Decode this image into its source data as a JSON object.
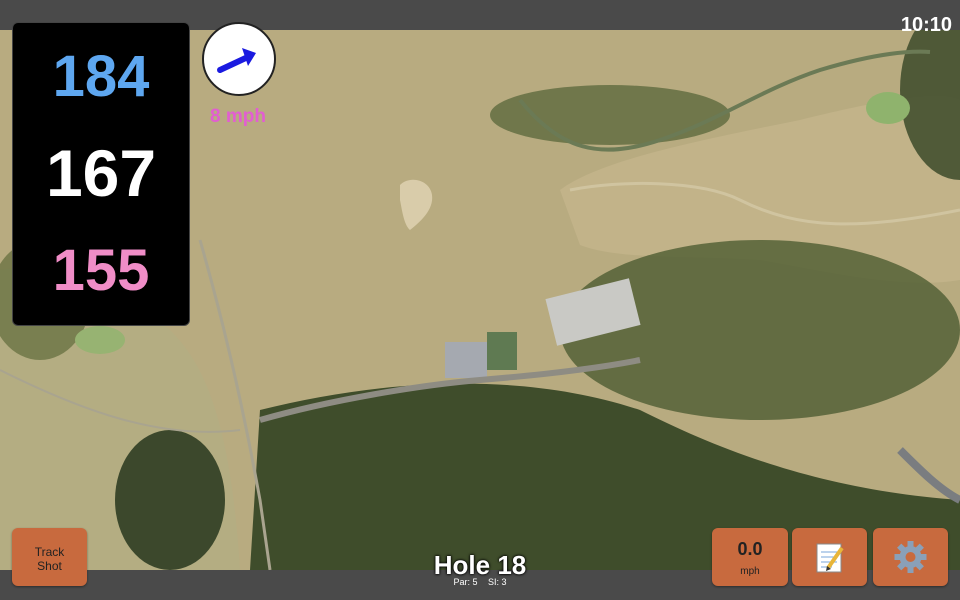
{
  "status_bar": {
    "time": "10:10"
  },
  "distances": {
    "back": "184",
    "middle": "167",
    "front": "155"
  },
  "wind": {
    "speed": "8 mph",
    "icon": "wind-arrow-icon"
  },
  "hole": {
    "title": "Hole 18",
    "par": "Par: 5",
    "stroke_index": "SI: 3"
  },
  "buttons": {
    "track_shot": {
      "line1": "Track",
      "line2": "Shot"
    },
    "speed": {
      "value": "0.0",
      "unit": "mph"
    },
    "notes": {
      "icon": "notepad-icon"
    },
    "settings": {
      "icon": "gear-icon"
    }
  },
  "colors": {
    "back": "#5ea7f0",
    "middle": "#ffffff",
    "front": "#f08dc7",
    "wind": "#e25ed1",
    "button": "#c86a3e",
    "bar": "#4a4a4a"
  }
}
